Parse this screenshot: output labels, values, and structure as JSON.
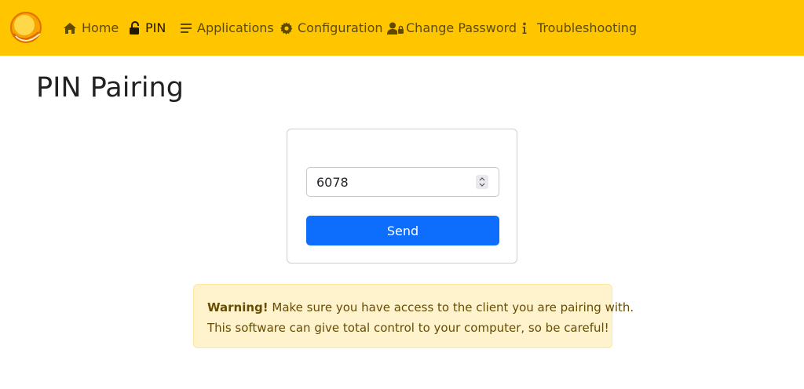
{
  "nav": {
    "logo_name": "sunshine-logo",
    "items": [
      {
        "label": "Home",
        "icon": "home-icon"
      },
      {
        "label": "PIN",
        "icon": "unlock-icon",
        "active": true
      },
      {
        "label": "Applications",
        "icon": "list-icon"
      },
      {
        "label": "Configuration",
        "icon": "gear-icon"
      },
      {
        "label": "Change Password",
        "icon": "user-lock-icon"
      },
      {
        "label": "Troubleshooting",
        "icon": "info-icon"
      }
    ]
  },
  "page": {
    "title": "PIN Pairing"
  },
  "form": {
    "pin_value": "6078",
    "send_label": "Send"
  },
  "alert": {
    "strong": "Warning!",
    "line1": " Make sure you have access to the client you are pairing with.",
    "line2": "This software can give total control to your computer, so be careful!"
  },
  "colors": {
    "navbar_bg": "#ffc600",
    "primary_button": "#0d6efd",
    "warning_bg": "#fff3cd",
    "warning_text": "#664d03"
  }
}
